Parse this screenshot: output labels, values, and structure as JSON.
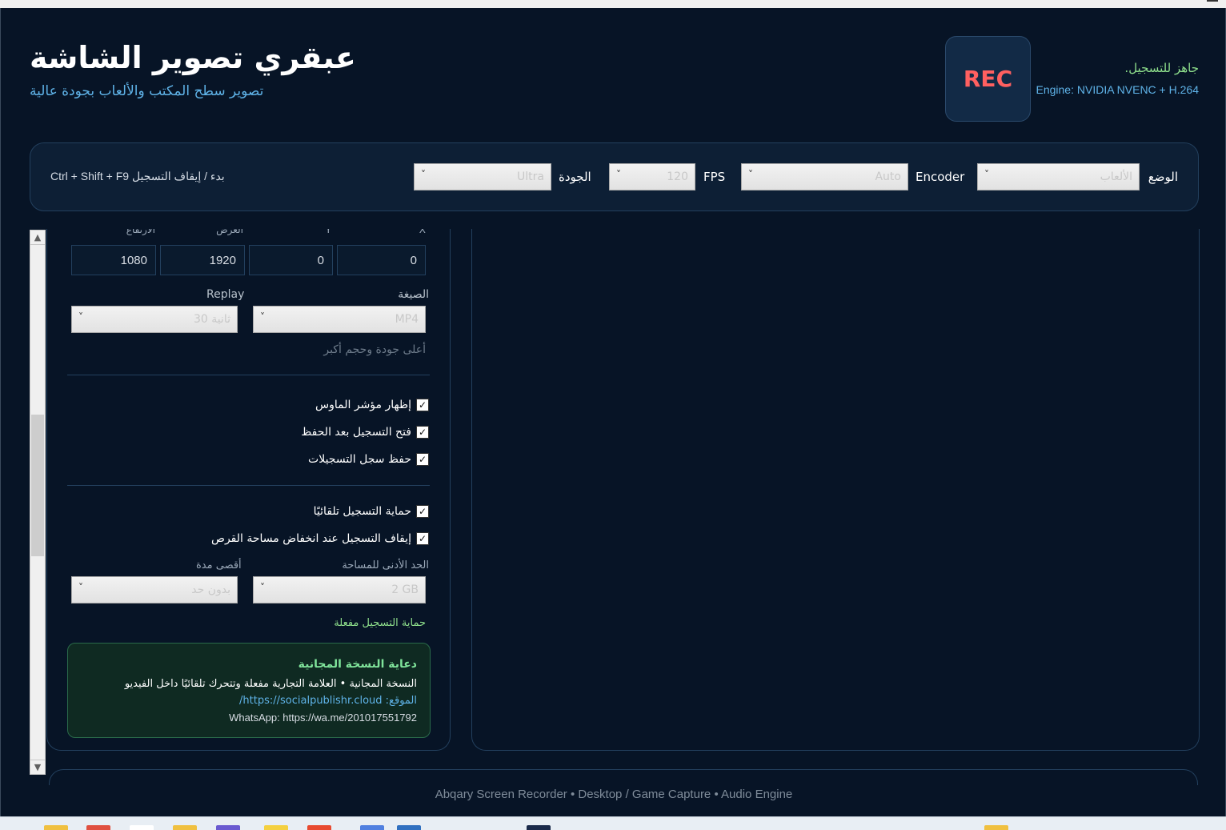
{
  "app": {
    "title": "عبقري تصوير الشاشة",
    "subtitle": "تصوير سطح المكتب والألعاب بجودة عالية",
    "rec_label": "REC",
    "status_ready": "جاهز للتسجيل.",
    "status_engine": "Engine: NVIDIA NVENC + H.264"
  },
  "toolbar": {
    "mode_label": "الوضع",
    "mode_value": "الألعاب",
    "encoder_label": "Encoder",
    "encoder_value": "Auto",
    "fps_label": "FPS",
    "fps_value": "120",
    "quality_label": "الجودة",
    "quality_value": "Ultra",
    "hotkey_text": "Ctrl + Shift + F9  بدء / إيقاف التسجيل"
  },
  "region": {
    "labels": [
      "X",
      "Y",
      "العرض",
      "الارتفاع"
    ],
    "values": [
      "0",
      "0",
      "1920",
      "1080"
    ]
  },
  "format": {
    "format_label": "الصيغة",
    "format_value": "MP4",
    "replay_label": "Replay",
    "replay_value": "30 ثانية",
    "format_hint": "أعلى جودة وحجم أكبر"
  },
  "options": {
    "show_cursor": "إظهار مؤشر الماوس",
    "open_after_save": "فتح التسجيل بعد الحفظ",
    "save_log": "حفظ سجل التسجيلات",
    "auto_protect": "حماية التسجيل تلقائيًا",
    "stop_low_disk": "إيقاف التسجيل عند انخفاض مساحة القرص",
    "check_glyph": "✓"
  },
  "protection": {
    "min_space_label": "الحد الأدنى للمساحة",
    "min_space_value": "2 GB",
    "max_duration_label": "أقصى مدة",
    "max_duration_value": "بدون حد",
    "status": "حماية التسجيل مفعلة"
  },
  "promo": {
    "title": "دعاية النسخة المجانية",
    "line1": "النسخة المجانية • العلامة التجارية مفعلة وتتحرك تلقائيًا داخل الفيديو",
    "site": "الموقع: https://socialpublishr.cloud/",
    "whatsapp": "WhatsApp: https://wa.me/201017551792"
  },
  "footer": "Abqary Screen Recorder • Desktop / Game Capture • Audio Engine",
  "colors": {
    "background": "#071426",
    "panel_border": "#23405e",
    "rec_red": "#ff6060",
    "accent_blue": "#5fb3e8",
    "accent_green": "#8fe08c"
  },
  "icons": {
    "dropdown": "˅",
    "scroll_up": "▲",
    "scroll_down": "▼"
  }
}
